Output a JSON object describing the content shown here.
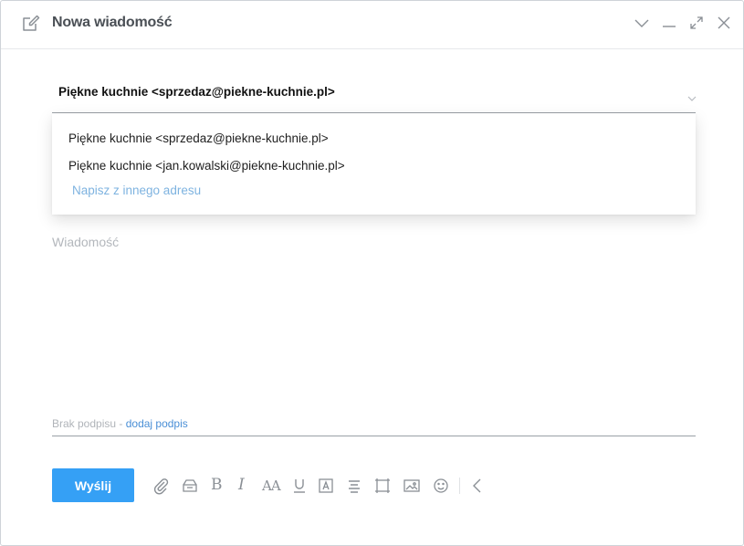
{
  "window": {
    "title": "Nowa wiadomość"
  },
  "sender": {
    "selected": "Piękne kuchnie <sprzedaz@piekne-kuchnie.pl>",
    "options": [
      "Piękne kuchnie <sprzedaz@piekne-kuchnie.pl>",
      "Piękne kuchnie <jan.kowalski@piekne-kuchnie.pl>"
    ],
    "other_address": "Napisz z innego adresu"
  },
  "message": {
    "placeholder": "Wiadomość"
  },
  "signature": {
    "none_label": "Brak podpisu - ",
    "add_link": "dodaj podpis"
  },
  "toolbar": {
    "send_label": "Wyślij",
    "bold_glyph": "B",
    "italic_glyph": "I",
    "font_size_glyph": "AA"
  },
  "colors": {
    "accent": "#35a0f5",
    "link": "#4a8fd6",
    "link_light": "#7eb3e0",
    "icon_gray": "#8a8f95"
  },
  "icons": {
    "compose": "compose-icon",
    "collapse": "chevron-down-icon",
    "minimize": "minimize-icon",
    "maximize": "maximize-icon",
    "close": "close-icon",
    "attach": "paperclip-icon",
    "template": "template-icon",
    "underline": "underline-icon",
    "text_box": "text-box-icon",
    "align": "align-icon",
    "frame": "frame-icon",
    "image": "image-icon",
    "emoji": "emoji-icon",
    "back": "chevron-left-icon"
  }
}
